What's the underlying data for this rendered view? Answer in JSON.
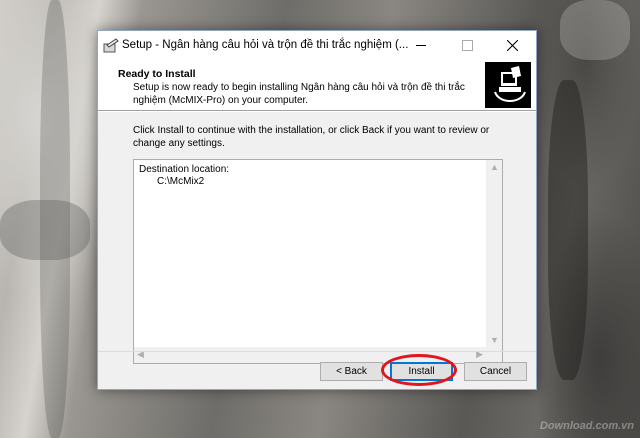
{
  "window": {
    "title": "Setup - Ngân hàng câu hỏi và trộn đề thi trắc nghiệm (..."
  },
  "header": {
    "title": "Ready to Install",
    "description": "Setup is now ready to begin installing Ngân hàng câu hỏi và trộn đề thi trắc nghiệm (McMIX-Pro) on your computer."
  },
  "body": {
    "instruction": "Click Install to continue with the installation, or click Back if you want to review or change any settings."
  },
  "summary": {
    "label": "Destination location:",
    "value": "C:\\McMix2"
  },
  "buttons": {
    "back": "< Back",
    "install": "Install",
    "cancel": "Cancel"
  },
  "watermark": "Download.com.vn",
  "colors": {
    "highlight": "#e3151a",
    "focus": "#0078d7"
  }
}
